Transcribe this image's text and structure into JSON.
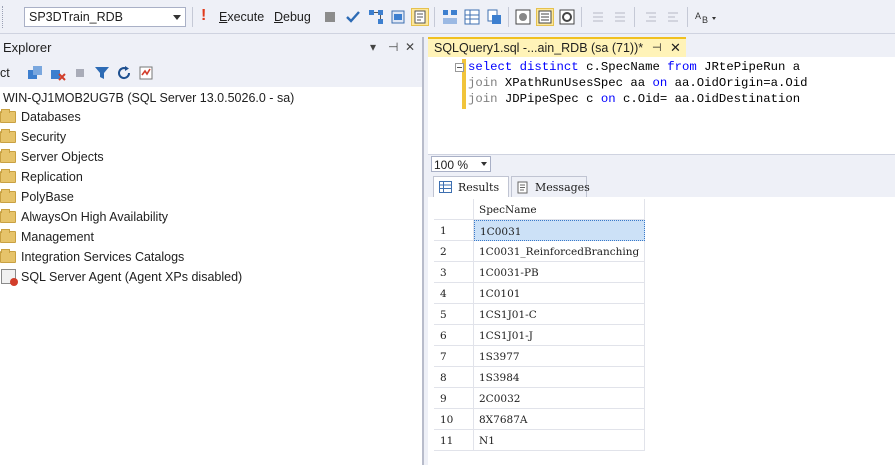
{
  "toolbar": {
    "database": "SP3DTrain_RDB",
    "execute_label": "Execute",
    "execute_mnemonic": "E",
    "execute_rest": "xecute",
    "debug_mnemonic": "D",
    "debug_rest": "ebug",
    "icons": [
      "execute-bang-icon",
      "debug-icon",
      "stop-icon",
      "parse-check-icon",
      "display-plan-icon",
      "query-designer-icon",
      "intellisense-icon",
      "results-to-text-icon",
      "results-to-grid-icon",
      "results-to-file-icon",
      "comment-icon",
      "uncomment-icon",
      "decrease-indent-icon",
      "increase-indent-icon",
      "specify-values-icon"
    ]
  },
  "explorer": {
    "title": "Explorer",
    "connect_label": "ct",
    "header_buttons": [
      "▾",
      "⊣",
      "✕"
    ],
    "server": "WIN-QJ1MOB2UG7B (SQL Server 13.0.5026.0 - sa)",
    "nodes": [
      {
        "label": "Databases",
        "icon": "folder-icon"
      },
      {
        "label": "Security",
        "icon": "folder-icon"
      },
      {
        "label": "Server Objects",
        "icon": "folder-icon"
      },
      {
        "label": "Replication",
        "icon": "folder-icon"
      },
      {
        "label": "PolyBase",
        "icon": "folder-icon"
      },
      {
        "label": "AlwaysOn High Availability",
        "icon": "folder-icon"
      },
      {
        "label": "Management",
        "icon": "folder-icon"
      },
      {
        "label": "Integration Services Catalogs",
        "icon": "folder-icon"
      },
      {
        "label": "SQL Server Agent (Agent XPs disabled)",
        "icon": "agent-icon"
      }
    ]
  },
  "document": {
    "tab_title": "SQLQuery1.sql -...ain_RDB (sa (71))*",
    "pin": "⊣",
    "close": "✕",
    "code": [
      {
        "kw": "select distinct",
        "rest": " c.SpecName ",
        "kw2": "from",
        "rest2": " JRtePipeRun a"
      },
      {
        "kw": "join",
        "rest": " XPathRunUsesSpec aa ",
        "kw2": "on",
        "rest2": " aa.OidOrigin=a.Oid"
      },
      {
        "kw": "join",
        "rest": " JDPipeSpec c ",
        "kw2": "on",
        "rest2": " c.Oid= aa.OidDestination"
      }
    ],
    "zoom": "100 %"
  },
  "results": {
    "tabs": [
      "Results",
      "Messages"
    ],
    "column": "SpecName",
    "rows": [
      {
        "n": "1",
        "v": "1C0031"
      },
      {
        "n": "2",
        "v": "1C0031_ReinforcedBranching"
      },
      {
        "n": "3",
        "v": "1C0031-PB"
      },
      {
        "n": "4",
        "v": "1C0101"
      },
      {
        "n": "5",
        "v": "1CS1J01-C"
      },
      {
        "n": "6",
        "v": "1CS1J01-J"
      },
      {
        "n": "7",
        "v": "1S3977"
      },
      {
        "n": "8",
        "v": "1S3984"
      },
      {
        "n": "9",
        "v": "2C0032"
      },
      {
        "n": "10",
        "v": "8X7687A"
      },
      {
        "n": "11",
        "v": "N1"
      }
    ]
  },
  "colors": {
    "selection": "#cce1f7",
    "tab_active": "#fff3b8",
    "keyword": "#0000ff"
  }
}
